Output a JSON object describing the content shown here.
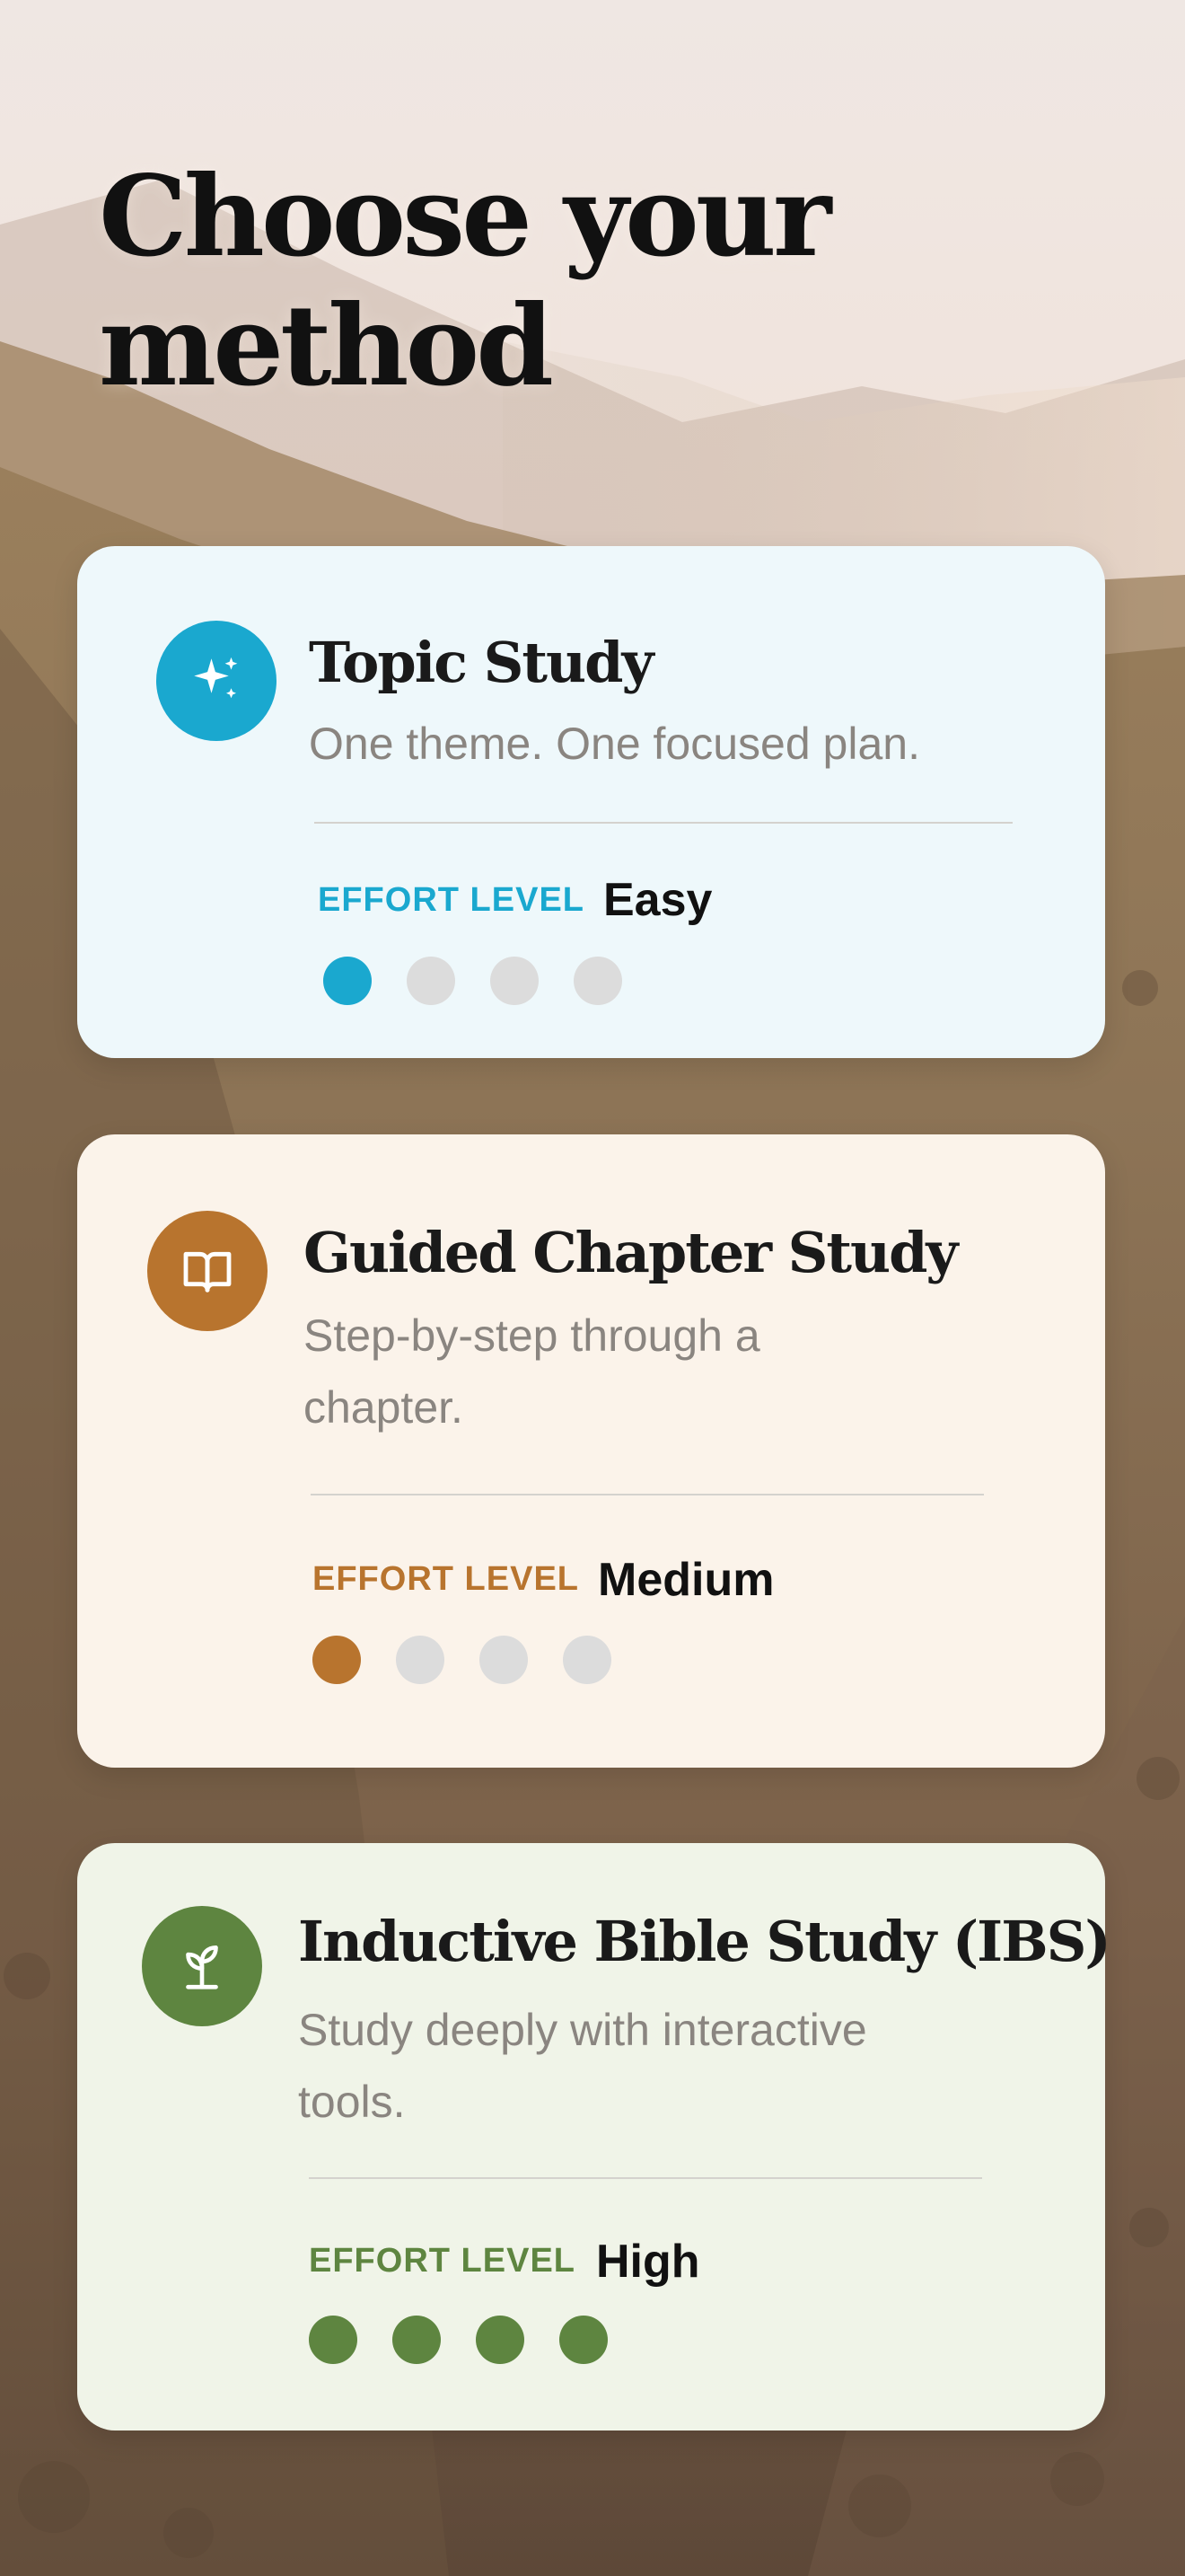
{
  "page": {
    "title": "Choose your method"
  },
  "methods": [
    {
      "id": "topic",
      "icon": "sparkles-icon",
      "accent": "#1aa8cf",
      "title": "Topic Study",
      "description": "One theme. One focused plan.",
      "effort_label": "EFFORT LEVEL",
      "effort_value": "Easy",
      "effort_level": 1,
      "effort_max": 4
    },
    {
      "id": "guided",
      "icon": "open-book-icon",
      "accent": "#b8742e",
      "title": "Guided Chapter Study",
      "description": "Step-by-step through a chapter.",
      "effort_label": "EFFORT LEVEL",
      "effort_value": "Medium",
      "effort_level": 1,
      "effort_max": 4
    },
    {
      "id": "ibs",
      "icon": "sprout-icon",
      "accent": "#5e8540",
      "title": "Inductive Bible Study (IBS)",
      "description": "Study deeply with interactive tools.",
      "effort_label": "EFFORT LEVEL",
      "effort_value": "High",
      "effort_level": 4,
      "effort_max": 4
    }
  ],
  "colors": {
    "dot_inactive": "#dcdcdc"
  }
}
